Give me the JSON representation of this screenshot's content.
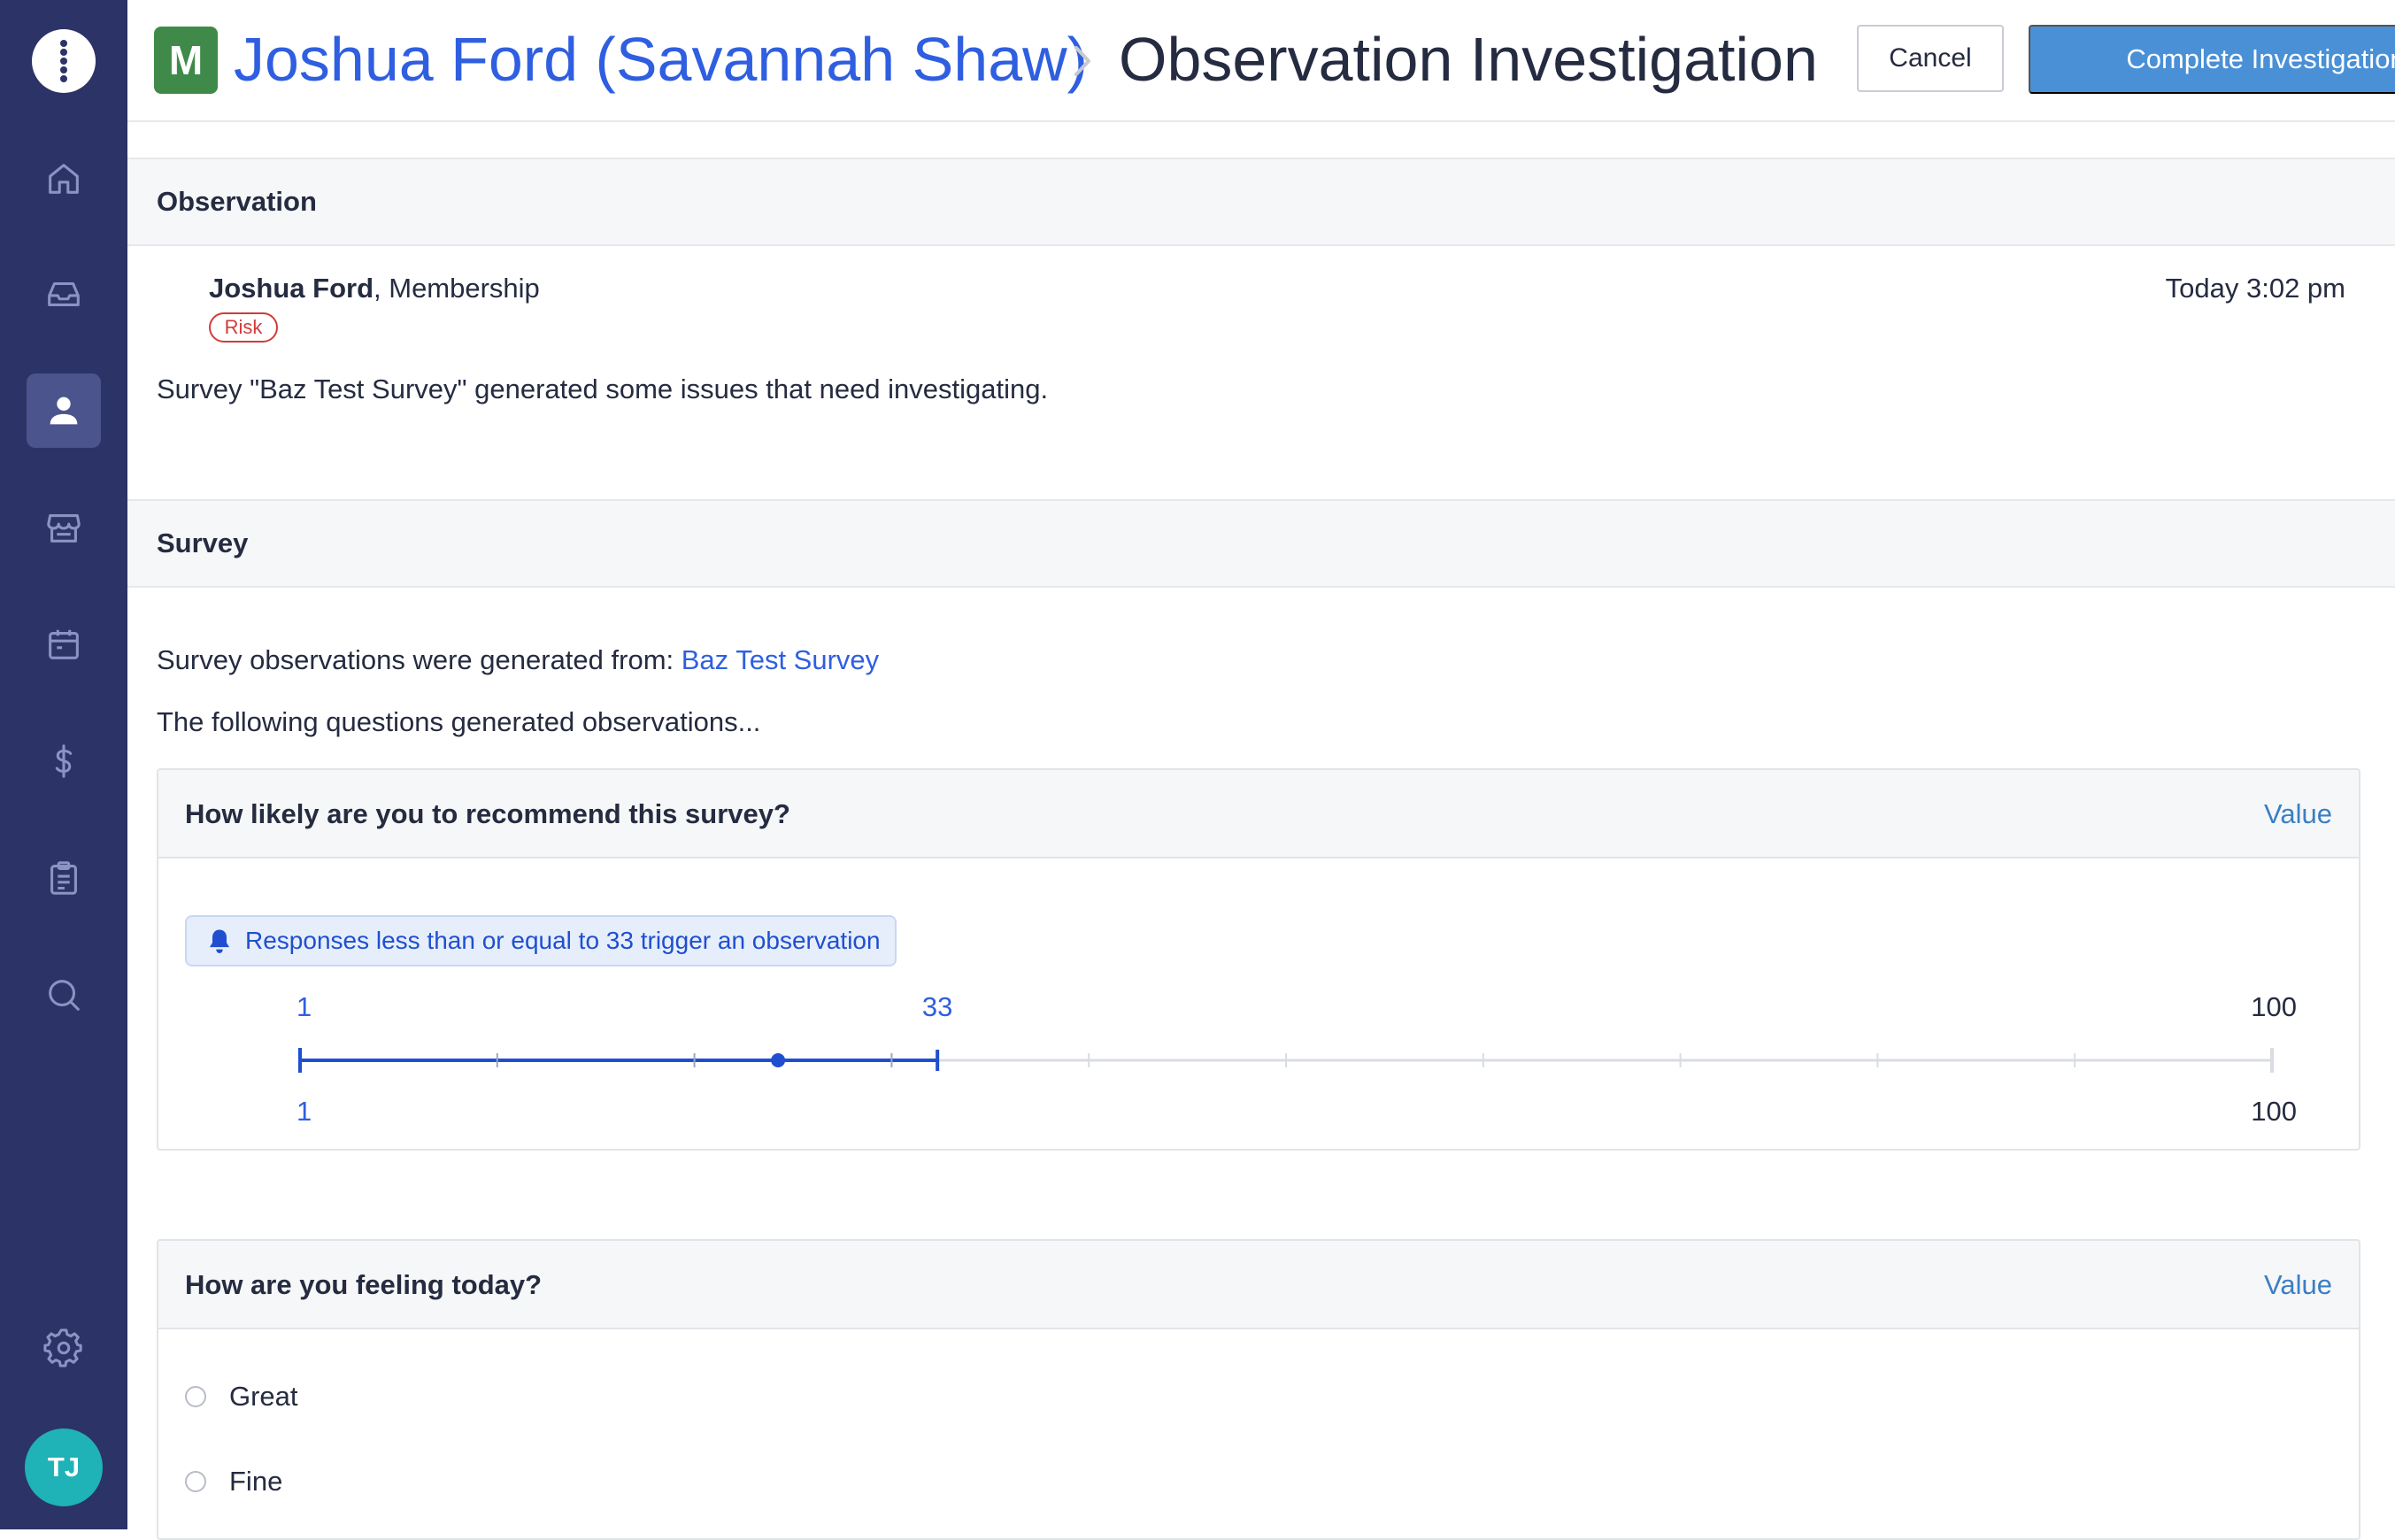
{
  "sidebar": {
    "nav": [
      {
        "icon": "home-icon",
        "active": false
      },
      {
        "icon": "inbox-icon",
        "active": false
      },
      {
        "icon": "person-icon",
        "active": true
      },
      {
        "icon": "storefront-icon",
        "active": false
      },
      {
        "icon": "calendar-icon",
        "active": false
      },
      {
        "icon": "dollar-icon",
        "active": false
      },
      {
        "icon": "clipboard-icon",
        "active": false
      },
      {
        "icon": "search-icon",
        "active": false
      }
    ],
    "settings_icon": "gear-icon",
    "user_initials": "TJ"
  },
  "header": {
    "org_badge": "M",
    "person_crumb": "Joshua Ford (Savannah Shaw)",
    "page_title": "Observation Investigation",
    "cancel_label": "Cancel",
    "complete_label": "Complete Investigation"
  },
  "observation": {
    "section_title": "Observation",
    "name": "Joshua Ford",
    "membership": ", Membership",
    "badge": "Risk",
    "time": "Today 3:02 pm",
    "text": "Survey \"Baz Test Survey\" generated some issues that need investigating."
  },
  "survey": {
    "section_title": "Survey",
    "generated_from_prefix": "Survey observations were generated from: ",
    "survey_link": "Baz Test Survey",
    "following_text": "The following questions generated observations...",
    "questions": [
      {
        "title": "How likely are you to recommend this survey?",
        "value_link": "Value",
        "trigger": "Responses less than or equal to 33 trigger an observation",
        "slider": {
          "min": 1,
          "max": 100,
          "threshold": 33,
          "response": 25,
          "top_min_label": "1",
          "top_threshold_label": "33",
          "top_max_label": "100",
          "bottom_min_label": "1",
          "bottom_max_label": "100"
        }
      },
      {
        "title": "How are you feeling today?",
        "value_link": "Value",
        "options": [
          "Great",
          "Fine"
        ]
      }
    ]
  },
  "colors": {
    "sidebar": "#2c3366",
    "accent": "#2f5fe0",
    "primary_button": "#4a90d6",
    "risk": "#d13b3b",
    "org_badge": "#3f8a49",
    "avatar": "#1fb2b6"
  }
}
